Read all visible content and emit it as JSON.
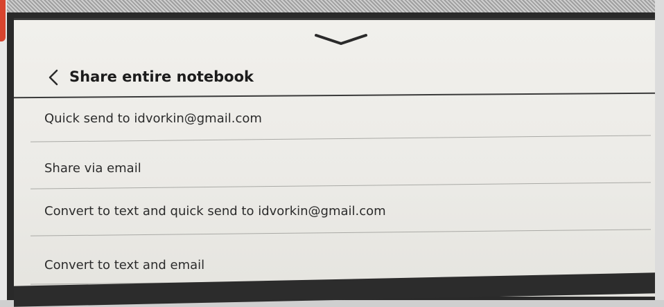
{
  "header": {
    "title": "Share entire notebook"
  },
  "menu": {
    "items": [
      {
        "label": "Quick send to idvorkin@gmail.com"
      },
      {
        "label": "Share via email"
      },
      {
        "label": "Convert to text and quick send to idvorkin@gmail.com"
      },
      {
        "label": "Convert to text and email"
      }
    ]
  },
  "icons": {
    "collapse": "chevron-down-icon",
    "back": "chevron-left-icon"
  },
  "colors": {
    "screen_background": "#eeede9",
    "text": "#2b2b2b",
    "divider": "#3a3a3a"
  }
}
